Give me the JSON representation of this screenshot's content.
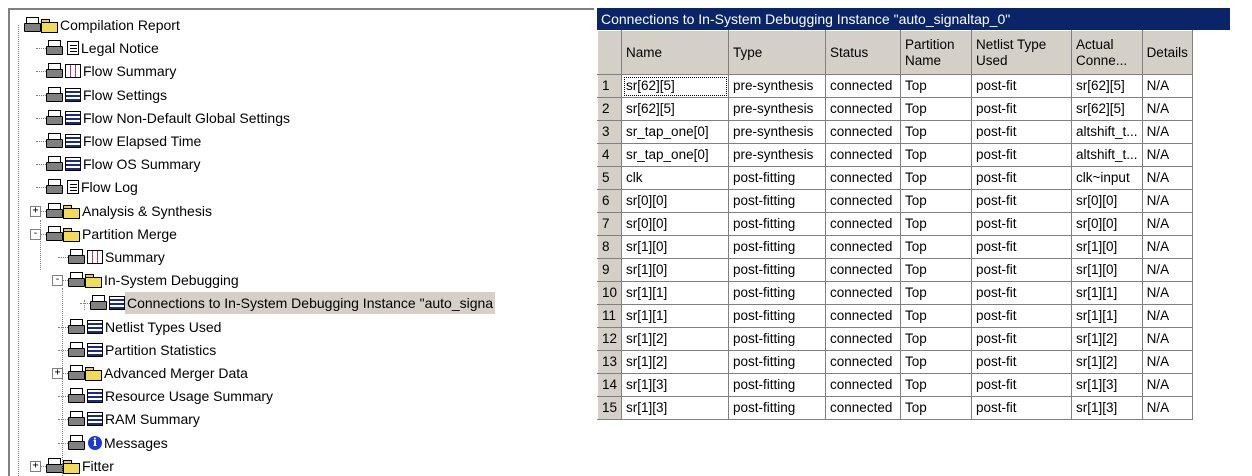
{
  "tree": {
    "items": [
      {
        "label": "Compilation Report",
        "icon": "folder-open-icon"
      },
      {
        "label": "Legal Notice",
        "icon": "document-icon"
      },
      {
        "label": "Flow Summary",
        "icon": "summary-table-icon"
      },
      {
        "label": "Flow Settings",
        "icon": "table-icon"
      },
      {
        "label": "Flow Non-Default Global Settings",
        "icon": "table-icon"
      },
      {
        "label": "Flow Elapsed Time",
        "icon": "table-icon"
      },
      {
        "label": "Flow OS Summary",
        "icon": "table-icon"
      },
      {
        "label": "Flow Log",
        "icon": "document-icon"
      },
      {
        "label": "Analysis & Synthesis",
        "icon": "folder-icon"
      },
      {
        "label": "Partition Merge",
        "icon": "folder-open-icon"
      },
      {
        "label": "Summary",
        "icon": "summary-table-icon"
      },
      {
        "label": "In-System Debugging",
        "icon": "folder-open-icon"
      },
      {
        "label": "Connections to In-System Debugging Instance \"auto_signa",
        "icon": "table-icon"
      },
      {
        "label": "Netlist Types Used",
        "icon": "table-icon"
      },
      {
        "label": "Partition Statistics",
        "icon": "table-icon"
      },
      {
        "label": "Advanced Merger Data",
        "icon": "folder-icon"
      },
      {
        "label": "Resource Usage Summary",
        "icon": "table-icon"
      },
      {
        "label": "RAM Summary",
        "icon": "table-icon"
      },
      {
        "label": "Messages",
        "icon": "info-icon"
      },
      {
        "label": "Fitter",
        "icon": "folder-icon"
      }
    ]
  },
  "panel": {
    "title": "Connections to In-System Debugging Instance \"auto_signaltap_0\"",
    "columns": [
      "Name",
      "Type",
      "Status",
      "Partition Name",
      "Netlist Type Used",
      "Actual Conne...",
      "Details"
    ],
    "rows": [
      [
        "1",
        "sr[62][5]",
        "pre-synthesis",
        "connected",
        "Top",
        "post-fit",
        "sr[62][5]",
        "N/A"
      ],
      [
        "2",
        "sr[62][5]",
        "pre-synthesis",
        "connected",
        "Top",
        "post-fit",
        "sr[62][5]",
        "N/A"
      ],
      [
        "3",
        "sr_tap_one[0]",
        "pre-synthesis",
        "connected",
        "Top",
        "post-fit",
        "altshift_t...",
        "N/A"
      ],
      [
        "4",
        "sr_tap_one[0]",
        "pre-synthesis",
        "connected",
        "Top",
        "post-fit",
        "altshift_t...",
        "N/A"
      ],
      [
        "5",
        "clk",
        "post-fitting",
        "connected",
        "Top",
        "post-fit",
        "clk~input",
        "N/A"
      ],
      [
        "6",
        "sr[0][0]",
        "post-fitting",
        "connected",
        "Top",
        "post-fit",
        "sr[0][0]",
        "N/A"
      ],
      [
        "7",
        "sr[0][0]",
        "post-fitting",
        "connected",
        "Top",
        "post-fit",
        "sr[0][0]",
        "N/A"
      ],
      [
        "8",
        "sr[1][0]",
        "post-fitting",
        "connected",
        "Top",
        "post-fit",
        "sr[1][0]",
        "N/A"
      ],
      [
        "9",
        "sr[1][0]",
        "post-fitting",
        "connected",
        "Top",
        "post-fit",
        "sr[1][0]",
        "N/A"
      ],
      [
        "10",
        "sr[1][1]",
        "post-fitting",
        "connected",
        "Top",
        "post-fit",
        "sr[1][1]",
        "N/A"
      ],
      [
        "11",
        "sr[1][1]",
        "post-fitting",
        "connected",
        "Top",
        "post-fit",
        "sr[1][1]",
        "N/A"
      ],
      [
        "12",
        "sr[1][2]",
        "post-fitting",
        "connected",
        "Top",
        "post-fit",
        "sr[1][2]",
        "N/A"
      ],
      [
        "13",
        "sr[1][2]",
        "post-fitting",
        "connected",
        "Top",
        "post-fit",
        "sr[1][2]",
        "N/A"
      ],
      [
        "14",
        "sr[1][3]",
        "post-fitting",
        "connected",
        "Top",
        "post-fit",
        "sr[1][3]",
        "N/A"
      ],
      [
        "15",
        "sr[1][3]",
        "post-fitting",
        "connected",
        "Top",
        "post-fit",
        "sr[1][3]",
        "N/A"
      ]
    ]
  },
  "colors": {
    "title_bar": "#0a246a",
    "header_bg": "#d4d0c8",
    "selection": "#d4d0c8"
  }
}
